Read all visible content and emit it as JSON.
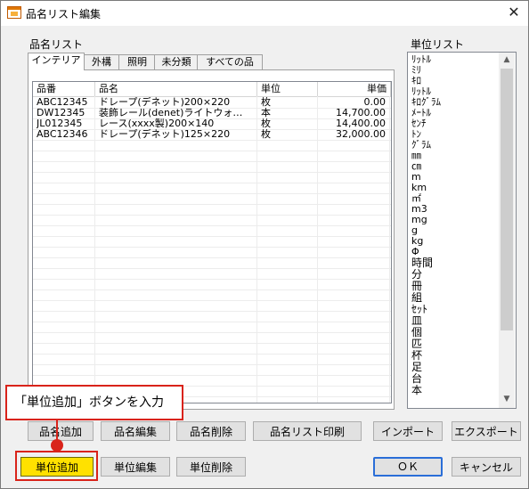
{
  "window": {
    "title": "品名リスト編集",
    "close_glyph": "✕"
  },
  "product_list": {
    "label": "品名リスト",
    "tabs": [
      "インテリア",
      "外構",
      "照明",
      "未分類",
      "すべての品"
    ],
    "active_tab": "インテリア",
    "columns": [
      "品番",
      "品名",
      "単位",
      "単価"
    ],
    "rows": [
      {
        "code": "ABC12345",
        "name": "ドレープ(デネット)200×220",
        "unit": "枚",
        "price": "0.00"
      },
      {
        "code": "DW12345",
        "name": "装飾レール(denet)ライトウォ…",
        "unit": "本",
        "price": "14,700.00"
      },
      {
        "code": "JL012345",
        "name": "レース(xxxx製)200×140",
        "unit": "枚",
        "price": "14,400.00"
      },
      {
        "code": "ABC12346",
        "name": "ドレープ(デネット)125×220",
        "unit": "枚",
        "price": "32,000.00"
      }
    ]
  },
  "unit_list": {
    "label": "単位リスト",
    "items": [
      "ﾘｯﾄﾙ",
      "ﾐﾘ",
      "ｷﾛ",
      "ﾘｯﾄﾙ",
      "ｷﾛｸﾞﾗﾑ",
      "ﾒｰﾄﾙ",
      "ｾﾝﾁ",
      "ﾄﾝ",
      "ｸﾞﾗﾑ",
      "㎜",
      "㎝",
      "m",
      "km",
      "㎡",
      "m3",
      "mg",
      "g",
      "kg",
      "Φ",
      "時間",
      "分",
      "冊",
      "組",
      "ｾｯﾄ",
      "皿",
      "個",
      "匹",
      "杯",
      "足",
      "台",
      "本"
    ],
    "scroll_up": "▲",
    "scroll_down": "▼"
  },
  "buttons": {
    "add_product": "品名追加",
    "edit_product": "品名編集",
    "delete_product": "品名削除",
    "print_product_list": "品名リスト印刷",
    "import": "インポート",
    "export": "エクスポート",
    "add_unit": "単位追加",
    "edit_unit": "単位編集",
    "delete_unit": "単位削除",
    "ok": "ＯＫ",
    "cancel": "キャンセル"
  },
  "annotation": {
    "callout_text": "「単位追加」ボタンを入力",
    "accent_color": "#d9231a",
    "highlight_color": "#ffe100"
  }
}
